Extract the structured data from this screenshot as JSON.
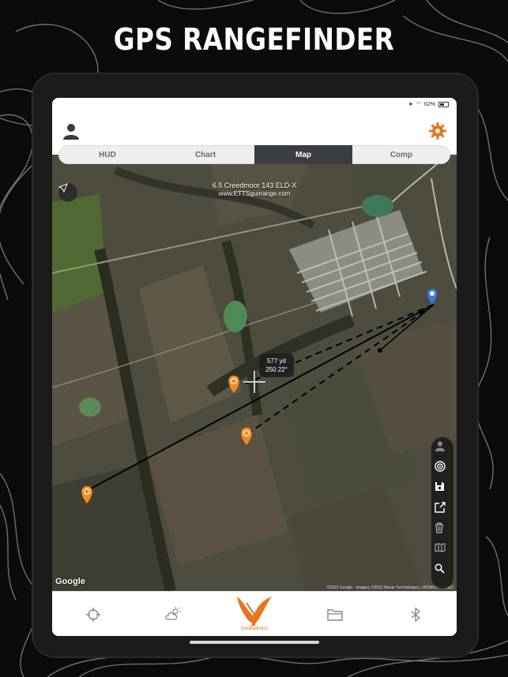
{
  "headline": "GPS RANGEFINDER",
  "status": {
    "battery": "62%"
  },
  "tabs": [
    {
      "label": "HUD",
      "active": false
    },
    {
      "label": "Chart",
      "active": false
    },
    {
      "label": "Map",
      "active": true
    },
    {
      "label": "Comp",
      "active": false
    }
  ],
  "map": {
    "load_title": "6.5 Creedmoor 143 ELD-X",
    "range_name": "www.ETTSgunrange.com",
    "range_distance": "577 yd",
    "range_bearing": "250.22°",
    "google_label": "Google",
    "attribution": "©2022 Google · Imagery ©2022 Maxar Technologies, USDA/FPAC/GEO"
  },
  "toolbar": {
    "items": [
      "person-icon",
      "target-icon",
      "save-icon",
      "share-icon",
      "trash-icon",
      "map-icon",
      "search-icon"
    ]
  },
  "bottom_nav": {
    "items": [
      "crosshair-icon",
      "weather-icon",
      "geoballistics-logo",
      "folder-icon",
      "bluetooth-icon"
    ],
    "brand_label": "GeoBallistics"
  },
  "colors": {
    "accent": "#e8761e",
    "tab_active": "#3a3e43",
    "shooter_pin": "#2f7de1",
    "target_pin": "#f08a24"
  }
}
